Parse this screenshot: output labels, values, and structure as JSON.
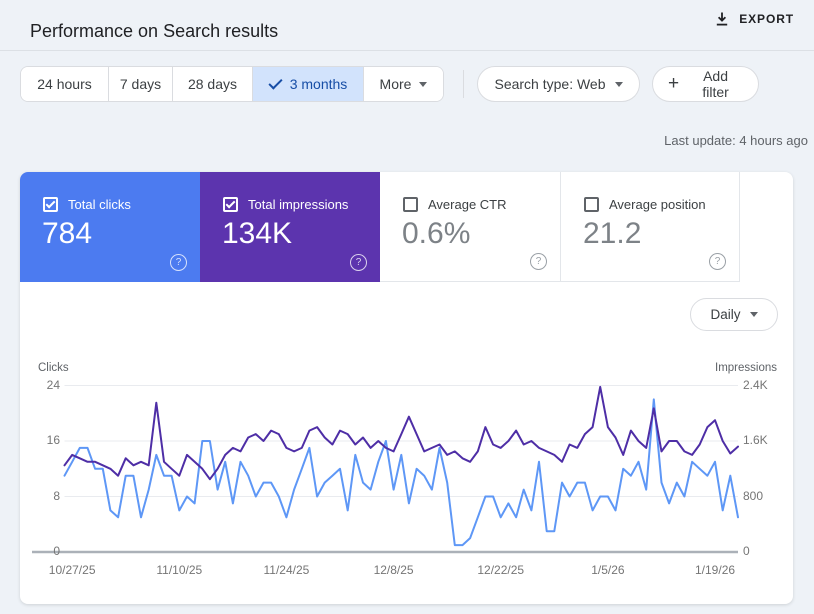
{
  "header": {
    "title": "Performance on Search results",
    "export_label": "EXPORT"
  },
  "filters": {
    "ranges": [
      "24 hours",
      "7 days",
      "28 days",
      "3 months"
    ],
    "selected_range": "3 months",
    "selected_index": 3,
    "more_label": "More",
    "search_type_label": "Search type: Web",
    "add_filter_label": "Add filter"
  },
  "icons": {
    "help": "?",
    "plus": "+"
  },
  "last_update": "Last update: 4 hours ago",
  "metrics": {
    "cards": [
      {
        "label": "Total clicks",
        "value": "784",
        "checked": true,
        "color": "#4c7bf0"
      },
      {
        "label": "Total impressions",
        "value": "134K",
        "checked": true,
        "color": "#5c34ae"
      },
      {
        "label": "Average CTR",
        "value": "0.6%",
        "checked": false,
        "color": ""
      },
      {
        "label": "Average position",
        "value": "21.2",
        "checked": false,
        "color": ""
      }
    ]
  },
  "granularity": {
    "label": "Daily"
  },
  "chart_data": {
    "type": "line",
    "x_start_date": "10/26/25",
    "x_tick_labels": [
      "10/27/25",
      "11/10/25",
      "11/24/25",
      "12/8/25",
      "12/22/25",
      "1/5/26",
      "1/19/26"
    ],
    "x_tick_day_indices": [
      1,
      15,
      29,
      43,
      57,
      71,
      85
    ],
    "left_axis": {
      "label": "Clicks",
      "ticks": [
        "24",
        "16",
        "8",
        "0"
      ],
      "max": 24
    },
    "right_axis": {
      "label": "Impressions",
      "ticks": [
        "2.4K",
        "1.6K",
        "800",
        "0"
      ],
      "max": 2400
    },
    "grid": true,
    "series": [
      {
        "name": "Clicks",
        "axis": "left",
        "color": "#5e97f6",
        "values": [
          11,
          13,
          15,
          15,
          12,
          12,
          6,
          5,
          11,
          11,
          5,
          9,
          14,
          11,
          11,
          6,
          8,
          7,
          16,
          16,
          9,
          13,
          7,
          13,
          11,
          8,
          10,
          10,
          8,
          5,
          9,
          12,
          15,
          8,
          10,
          11,
          12,
          6,
          14,
          10,
          9,
          13,
          16,
          9,
          14,
          7,
          12,
          11,
          9,
          15,
          10,
          1,
          1,
          2,
          5,
          8,
          8,
          5,
          7,
          5,
          9,
          6,
          13,
          3,
          3,
          10,
          8,
          10,
          10,
          6,
          8,
          8,
          6,
          12,
          11,
          13,
          9,
          22,
          10,
          7,
          10,
          8,
          13,
          12,
          11,
          13,
          6,
          11,
          5
        ]
      },
      {
        "name": "Impressions",
        "axis": "right",
        "color": "#4e2ea6",
        "values": [
          1250,
          1400,
          1350,
          1300,
          1300,
          1250,
          1200,
          1100,
          1350,
          1250,
          1300,
          1250,
          2150,
          1300,
          1200,
          1100,
          1400,
          1300,
          1200,
          1050,
          1200,
          1400,
          1500,
          1450,
          1650,
          1700,
          1600,
          1750,
          1700,
          1500,
          1450,
          1500,
          1750,
          1800,
          1650,
          1550,
          1750,
          1700,
          1550,
          1650,
          1500,
          1600,
          1500,
          1450,
          1700,
          1950,
          1700,
          1450,
          1500,
          1550,
          1400,
          1450,
          1350,
          1300,
          1450,
          1800,
          1550,
          1500,
          1600,
          1750,
          1550,
          1600,
          1500,
          1450,
          1400,
          1300,
          1550,
          1500,
          1700,
          1800,
          2380,
          1800,
          1650,
          1400,
          1750,
          1600,
          1500,
          2070,
          1450,
          1600,
          1600,
          1450,
          1400,
          1550,
          1800,
          1900,
          1600,
          1420,
          1520
        ]
      }
    ]
  }
}
